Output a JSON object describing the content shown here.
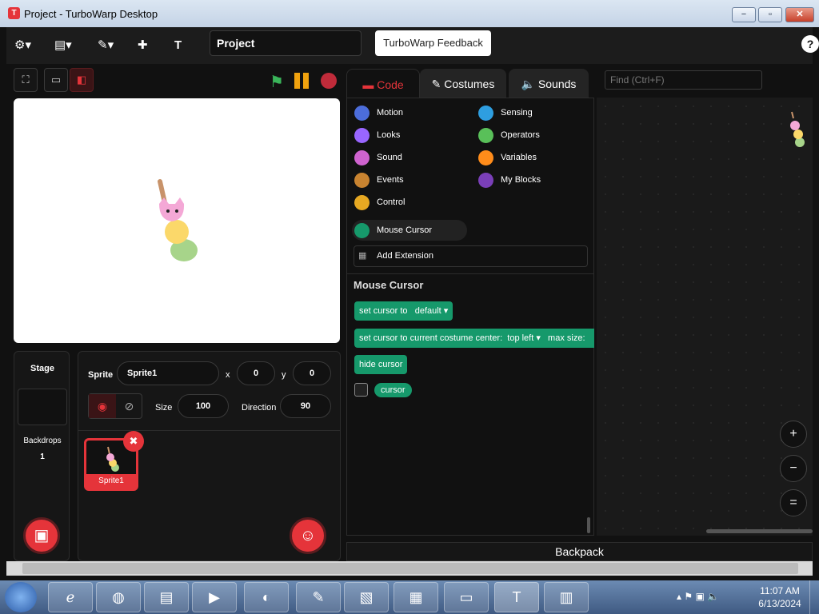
{
  "window": {
    "title": "Project - TurboWarp Desktop",
    "min": "−",
    "max": "▫",
    "close": "✕",
    "app_icon": "T"
  },
  "menubar": {
    "settings_icon": "⚙▾",
    "file_icon": "▤▾",
    "edit_icon": "✎▾",
    "extensions_icon": "✚",
    "addons_icon": "T",
    "project_title": "Project",
    "feedback_label": "TurboWarp Feedback",
    "help_icon": "?"
  },
  "stage_controls": {
    "fullscreen": "⛶",
    "small_stage": "▭",
    "large_stage": "◧",
    "flag": "⚑"
  },
  "tabs": {
    "code": "Code",
    "costumes": "Costumes",
    "sounds": "Sounds"
  },
  "categories": [
    {
      "label": "Motion",
      "color": "#4c6ddb"
    },
    {
      "label": "Looks",
      "color": "#9966ff"
    },
    {
      "label": "Sound",
      "color": "#cf63cf"
    },
    {
      "label": "Events",
      "color": "#c88330"
    },
    {
      "label": "Control",
      "color": "#e6a822"
    },
    {
      "label": "Sensing",
      "color": "#2e9ee0"
    },
    {
      "label": "Operators",
      "color": "#59c059"
    },
    {
      "label": "Variables",
      "color": "#ff8c1a"
    },
    {
      "label": "My Blocks",
      "color": "#7a3fb8"
    }
  ],
  "mouse_cursor_category": {
    "label": "Mouse Cursor",
    "color": "#16996b"
  },
  "add_extension": "Add Extension",
  "palette_heading": "Mouse Cursor",
  "blocks": {
    "set_cursor": "set cursor to",
    "set_cursor_value": "default",
    "set_costume": "set cursor to current costume center:",
    "set_costume_value": "top left",
    "max_size": "max size:",
    "hide_cursor": "hide cursor",
    "cursor_reporter": "cursor"
  },
  "find_placeholder": "Find (Ctrl+F)",
  "zoom": {
    "in": "+",
    "out": "−",
    "reset": "="
  },
  "stage_panel": {
    "title": "Stage",
    "backdrops_label": "Backdrops",
    "backdrops_count": "1"
  },
  "sprite_info": {
    "sprite_label": "Sprite",
    "sprite_name": "Sprite1",
    "x_label": "x",
    "x_value": "0",
    "y_label": "y",
    "y_value": "0",
    "size_label": "Size",
    "size_value": "100",
    "direction_label": "Direction",
    "direction_value": "90"
  },
  "sprite_tile": {
    "name": "Sprite1"
  },
  "backpack": "Backpack",
  "taskbar": {
    "time": "11:07 AM",
    "date": "6/13/2024"
  }
}
